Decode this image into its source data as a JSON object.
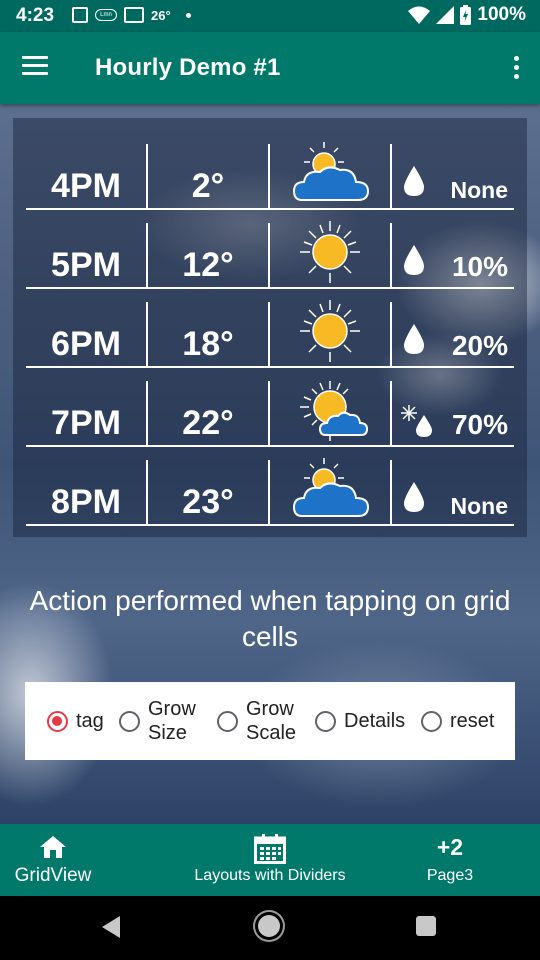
{
  "status_bar": {
    "time": "4:23",
    "temperature": "26°",
    "battery": "100%",
    "notif_pill": "Lmn"
  },
  "app_bar": {
    "title": "Hourly Demo #1"
  },
  "hourly": [
    {
      "hour": "4PM",
      "temp": "2°",
      "icon": "cloud-sun-small-icon",
      "precip_icon": "raindrop-icon",
      "precip": "None"
    },
    {
      "hour": "5PM",
      "temp": "12°",
      "icon": "sun-icon",
      "precip_icon": "raindrop-icon",
      "precip": "10%"
    },
    {
      "hour": "6PM",
      "temp": "18°",
      "icon": "sun-icon",
      "precip_icon": "raindrop-icon",
      "precip": "20%"
    },
    {
      "hour": "7PM",
      "temp": "22°",
      "icon": "sun-cloud-icon",
      "precip_icon": "snow-rain-icon",
      "precip": "70%"
    },
    {
      "hour": "8PM",
      "temp": "23°",
      "icon": "cloud-sun-small-icon",
      "precip_icon": "raindrop-icon",
      "precip": "None"
    }
  ],
  "caption": "Action performed when tapping on grid cells",
  "radio_options": [
    {
      "label_line1": "tag",
      "label_line2": "",
      "checked": true
    },
    {
      "label_line1": "Grow",
      "label_line2": "Size",
      "checked": false
    },
    {
      "label_line1": "Grow",
      "label_line2": "Scale",
      "checked": false
    },
    {
      "label_line1": "Details",
      "label_line2": "",
      "checked": false
    },
    {
      "label_line1": "reset",
      "label_line2": "",
      "checked": false
    }
  ],
  "bottom_nav": {
    "items": [
      {
        "label": "GridView",
        "icon": "home-icon",
        "active": true
      },
      {
        "label": "Layouts with Dividers",
        "icon": "calendar-icon",
        "active": false
      },
      {
        "label": "Page3",
        "badge": "+2",
        "active": false
      }
    ]
  },
  "colors": {
    "primary": "#00796b",
    "primary_dark": "#00695f",
    "accent": "#e53945",
    "sun": "#f7b924",
    "cloud": "#1e73c8"
  }
}
